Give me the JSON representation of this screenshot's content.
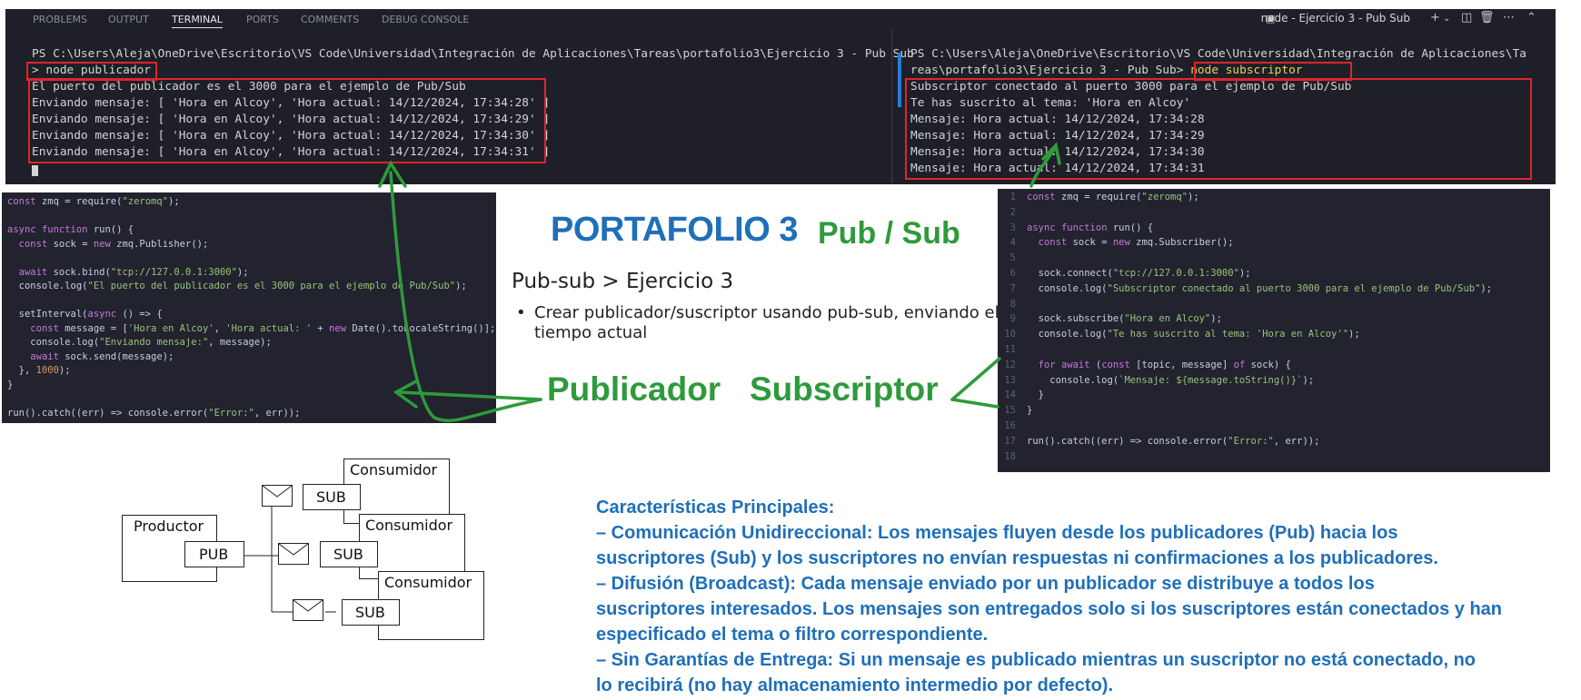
{
  "terminal": {
    "tabs": [
      "PROBLEMS",
      "OUTPUT",
      "TERMINAL",
      "PORTS",
      "COMMENTS",
      "DEBUG CONSOLE"
    ],
    "active_tab": "TERMINAL",
    "window_title": "node - Ejercicio 3 - Pub Sub",
    "left": {
      "prompt": "PS C:\\Users\\Aleja\\OneDrive\\Escritorio\\VS Code\\Universidad\\Integración de Aplicaciones\\Tareas\\portafolio3\\Ejercicio 3 - Pub Sub",
      "command": "> node publicador",
      "output": [
        "El puerto del publicador es el 3000 para el ejemplo de Pub/Sub",
        "Enviando mensaje: [ 'Hora en Alcoy', 'Hora actual: 14/12/2024, 17:34:28' ]",
        "Enviando mensaje: [ 'Hora en Alcoy', 'Hora actual: 14/12/2024, 17:34:29' ]",
        "Enviando mensaje: [ 'Hora en Alcoy', 'Hora actual: 14/12/2024, 17:34:30' ]",
        "Enviando mensaje: [ 'Hora en Alcoy', 'Hora actual: 14/12/2024, 17:34:31' ]"
      ]
    },
    "right": {
      "prompt_line1": "PS C:\\Users\\Aleja\\OneDrive\\Escritorio\\VS Code\\Universidad\\Integración de Aplicaciones\\Ta",
      "prompt_line2": "reas\\portafolio3\\Ejercicio 3 - Pub Sub>",
      "command": "node subscriptor",
      "output": [
        "Subscriptor conectado al puerto 3000 para el ejemplo de Pub/Sub",
        "Te has suscrito al tema: 'Hora en Alcoy'",
        "Mensaje: Hora actual: 14/12/2024, 17:34:28",
        "Mensaje: Hora actual: 14/12/2024, 17:34:29",
        "Mensaje: Hora actual: 14/12/2024, 17:34:30",
        "Mensaje: Hora actual: 14/12/2024, 17:34:31"
      ]
    }
  },
  "publisher_code": [
    "const zmq = require(\"zeromq\");",
    "",
    "async function run() {",
    "  const sock = new zmq.Publisher();",
    "",
    "  await sock.bind(\"tcp://127.0.0.1:3000\");",
    "  console.log(\"El puerto del publicador es el 3000 para el ejemplo de Pub/Sub\");",
    "",
    "  setInterval(async () => {",
    "    const message = ['Hora en Alcoy', 'Hora actual: ' + new Date().toLocaleString()];",
    "    console.log(\"Enviando mensaje:\", message);",
    "    await sock.send(message);",
    "  }, 1000);",
    "}",
    "",
    "run().catch((err) => console.error(\"Error:\", err));"
  ],
  "subscriber_code": {
    "line_numbers": [
      "1",
      "2",
      "3",
      "4",
      "5",
      "6",
      "7",
      "8",
      "9",
      "10",
      "11",
      "12",
      "13",
      "14",
      "15",
      "16",
      "17",
      "18"
    ],
    "lines": [
      "const zmq = require(\"zeromq\");",
      "",
      "async function run() {",
      "  const sock = new zmq.Subscriber();",
      "",
      "  sock.connect(\"tcp://127.0.0.1:3000\");",
      "  console.log(\"Subscriptor conectado al puerto 3000 para el ejemplo de Pub/Sub\");",
      "",
      "  sock.subscribe(\"Hora en Alcoy\");",
      "  console.log(\"Te has suscrito al tema: 'Hora en Alcoy'\");",
      "",
      "  for await (const [topic, message] of sock) {",
      "    console.log(`Mensaje: ${message.toString()}`);",
      "  }",
      "}",
      "",
      "run().catch((err) => console.error(\"Error:\", err));",
      ""
    ]
  },
  "slide": {
    "title": "PORTAFOLIO 3",
    "title_accent": "Pub / Sub",
    "subtitle": "Pub-sub > Ejercicio 3",
    "bullet": "Crear publicador/suscriptor usando pub-sub, enviando el tiempo actual",
    "label_publisher": "Publicador",
    "label_subscriber": "Subscriptor"
  },
  "diagram": {
    "producer": "Productor",
    "pub": "PUB",
    "sub": "SUB",
    "consumer": "Consumidor"
  },
  "features": {
    "heading": "Características Principales:",
    "lines": [
      " – Comunicación Unidireccional: Los mensajes fluyen desde los publicadores (Pub) hacia los",
      "suscriptores (Sub) y los suscriptores no envían respuestas ni confirmaciones a los publicadores.",
      " – Difusión (Broadcast):  Cada mensaje enviado por un publicador se distribuye a todos los",
      "suscriptores interesados. Los mensajes son entregados solo si los suscriptores están conectados y han",
      "especificado el tema o filtro correspondiente.",
      "– Sin Garantías de Entrega:  Si un mensaje es publicado mientras un suscriptor no está conectado, no",
      "lo recibirá (no hay almacenamiento intermedio por defecto)."
    ]
  },
  "colors": {
    "annotation_red": "#e0242b",
    "accent_green": "#2f9a3c",
    "accent_blue": "#1f6fb9",
    "terminal_bg": "#1e1f28"
  }
}
